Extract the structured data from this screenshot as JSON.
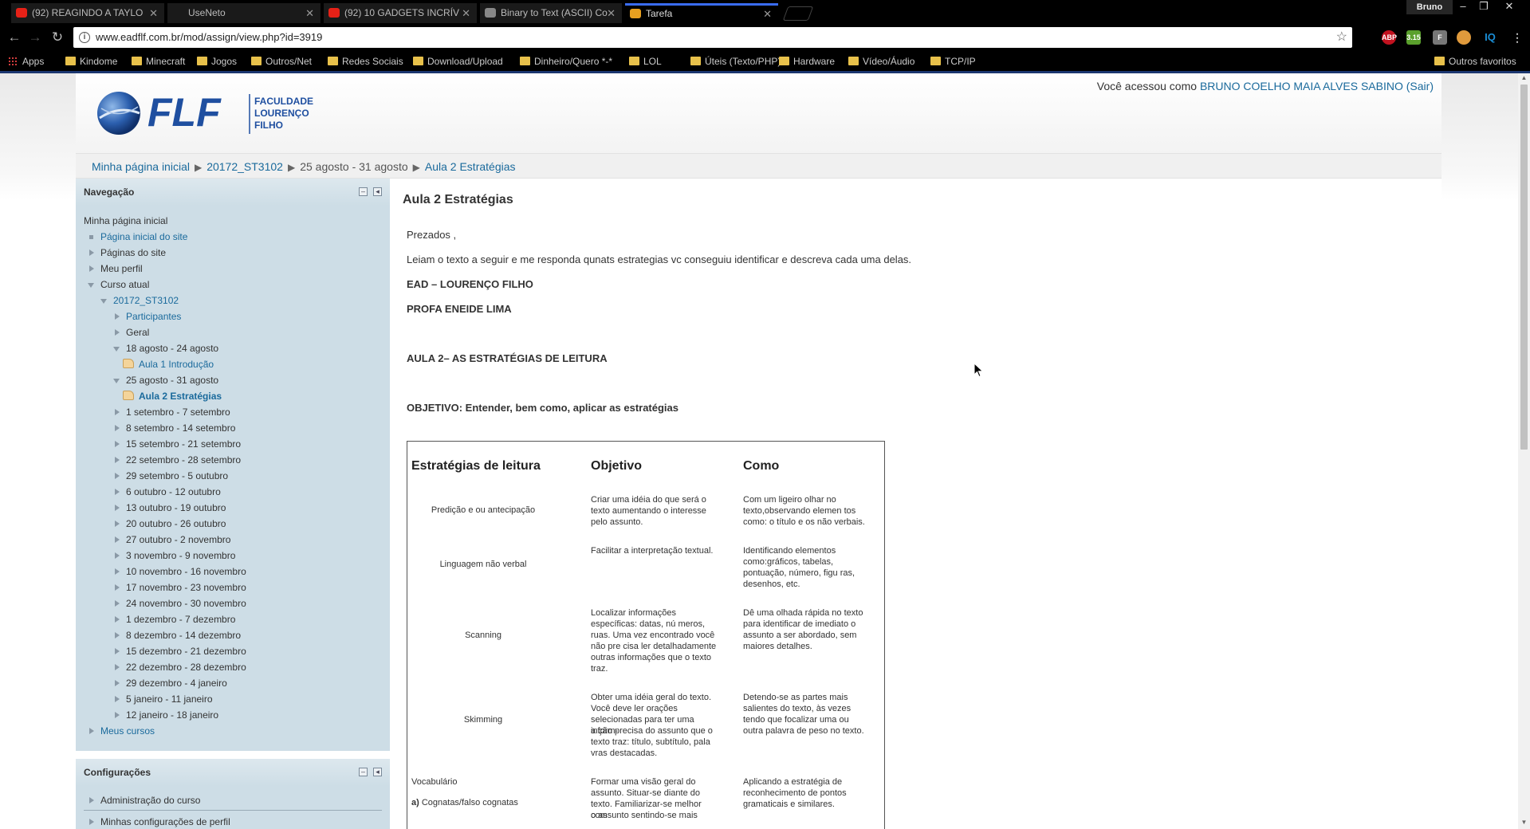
{
  "browser": {
    "tabs": [
      {
        "title": "(92) REAGINDO A TAYLO",
        "icon_color": "#e62117"
      },
      {
        "title": "UseNeto",
        "icon_color": ""
      },
      {
        "title": "(92) 10 GADGETS INCRÍV",
        "icon_color": "#e62117"
      },
      {
        "title": "Binary to Text (ASCII) Co",
        "icon_color": "#888888"
      },
      {
        "title": "Tarefa",
        "icon_color": "#e8a020"
      }
    ],
    "profile_name": "Bruno",
    "url_display": "www.eadflf.com.br/mod/assign/view.php?id=3919",
    "bookmarks": [
      "Apps",
      "Kindome",
      "Minecraft",
      "Jogos",
      "Outros/Net",
      "Redes Sociais",
      "Download/Upload",
      "Dinheiro/Quero *-*",
      "LOL",
      "Úteis (Texto/PHP)",
      "Hardware",
      "Vídeo/Áudio",
      "TCP/IP"
    ],
    "other_bookmarks": "Outros favoritos",
    "extensions": [
      {
        "label": "ABP",
        "color": "#c1121f"
      },
      {
        "label": "3.15",
        "color": "#5aa02c"
      },
      {
        "label": "F",
        "color": "#777777"
      },
      {
        "label": "",
        "color": "#e09a3c"
      },
      {
        "label": "IQ",
        "color": "#1a8fd8"
      }
    ]
  },
  "site": {
    "logo_text": "FLF",
    "logo_subtitle": [
      "FACULDADE",
      "LOURENÇO",
      "FILHO"
    ],
    "brand_color": "#1f4fa0",
    "login_prefix": "Você acessou como",
    "user_name": "BRUNO COELHO MAIA ALVES SABINO",
    "logout": "(Sair)",
    "breadcrumb": [
      "Minha página inicial",
      "20172_ST3102",
      "25 agosto - 31 agosto",
      "Aula 2 Estratégias"
    ]
  },
  "navigation": {
    "title": "Navegação",
    "home": "Minha página inicial",
    "items": [
      {
        "label": "Página inicial do site",
        "marker": "square",
        "link": true
      },
      {
        "label": "Páginas do site",
        "marker": "closed",
        "link": false
      },
      {
        "label": "Meu perfil",
        "marker": "closed",
        "link": false
      },
      {
        "label": "Curso atual",
        "marker": "open",
        "link": false
      },
      {
        "label": "20172_ST3102",
        "marker": "open",
        "link": true
      },
      {
        "label": "Participantes",
        "marker": "closed",
        "link": true
      },
      {
        "label": "Geral",
        "marker": "closed",
        "link": false
      },
      {
        "label": "18 agosto - 24 agosto",
        "marker": "open",
        "link": false
      },
      {
        "label": "Aula 1 Introdução",
        "marker": "resource",
        "link": true
      },
      {
        "label": "25 agosto - 31 agosto",
        "marker": "open",
        "link": false
      },
      {
        "label": "Aula 2 Estratégias",
        "marker": "resource",
        "link": true,
        "current": true
      },
      {
        "label": "1 setembro - 7 setembro",
        "marker": "closed",
        "link": false
      },
      {
        "label": "8 setembro - 14 setembro",
        "marker": "closed",
        "link": false
      },
      {
        "label": "15 setembro - 21 setembro",
        "marker": "closed",
        "link": false
      },
      {
        "label": "22 setembro - 28 setembro",
        "marker": "closed",
        "link": false
      },
      {
        "label": "29 setembro - 5 outubro",
        "marker": "closed",
        "link": false
      },
      {
        "label": "6 outubro - 12 outubro",
        "marker": "closed",
        "link": false
      },
      {
        "label": "13 outubro - 19 outubro",
        "marker": "closed",
        "link": false
      },
      {
        "label": "20 outubro - 26 outubro",
        "marker": "closed",
        "link": false
      },
      {
        "label": "27 outubro - 2 novembro",
        "marker": "closed",
        "link": false
      },
      {
        "label": "3 novembro - 9 novembro",
        "marker": "closed",
        "link": false
      },
      {
        "label": "10 novembro - 16 novembro",
        "marker": "closed",
        "link": false
      },
      {
        "label": "17 novembro - 23 novembro",
        "marker": "closed",
        "link": false
      },
      {
        "label": "24 novembro - 30 novembro",
        "marker": "closed",
        "link": false
      },
      {
        "label": "1 dezembro - 7 dezembro",
        "marker": "closed",
        "link": false
      },
      {
        "label": "8 dezembro - 14 dezembro",
        "marker": "closed",
        "link": false
      },
      {
        "label": "15 dezembro - 21 dezembro",
        "marker": "closed",
        "link": false
      },
      {
        "label": "22 dezembro - 28 dezembro",
        "marker": "closed",
        "link": false
      },
      {
        "label": "29 dezembro - 4 janeiro",
        "marker": "closed",
        "link": false
      },
      {
        "label": "5 janeiro - 11 janeiro",
        "marker": "closed",
        "link": false
      },
      {
        "label": "12 janeiro - 18 janeiro",
        "marker": "closed",
        "link": false
      },
      {
        "label": "Meus cursos",
        "marker": "closed",
        "link": true
      }
    ]
  },
  "settings": {
    "title": "Configurações",
    "items": [
      "Administração do curso",
      "Minhas configurações de perfil"
    ]
  },
  "assignment": {
    "title": "Aula 2 Estratégias",
    "greeting": "Prezados ,",
    "instruction": "Leiam o texto a seguir e me responda qunats estrategias vc conseguiu identificar e descreva cada uma delas.",
    "line1": "EAD – LOURENÇO FILHO",
    "line2": "PROFA ENEIDE LIMA",
    "line3": "AULA 2– AS ESTRATÉGIAS DE LEITURA",
    "line4": "OBJETIVO: Entender, bem como,  aplicar as estratégias",
    "table": {
      "headers": [
        "Estratégias de leitura",
        "Objetivo",
        "Como"
      ],
      "rows": [
        {
          "strategy": "Predição e ou antecipação",
          "objective": [
            "Criar uma idéia do que será o",
            "texto aumentando o interesse",
            "pelo assunto."
          ],
          "how": [
            "Com um ligeiro olhar no",
            "texto,observando elemen tos",
            "como: o título e os não verbais."
          ]
        },
        {
          "strategy": "Linguagem não verbal",
          "objective": [
            "Facilitar a interpretação textual."
          ],
          "how": [
            "Identificando elementos",
            "como:gráficos, tabelas,",
            "pontuação, número, figu ras,",
            "desenhos, etc."
          ]
        },
        {
          "strategy": "Scanning",
          "objective": [
            "Localizar informações",
            "específicas: datas, nú meros,",
            "ruas. Uma vez encontrado você",
            "não pre cisa ler detalhadamente",
            "outras informações que o texto",
            "traz."
          ],
          "how": [
            "Dê uma olhada rápida no texto",
            "para identificar de imediato o",
            "assunto a ser abordado, sem",
            "maiores detalhes."
          ]
        },
        {
          "strategy": "Skimming",
          "objective": [
            "Obter uma idéia geral do texto.",
            "Você deve ler orações",
            "selecionadas para ter uma inform-",
            "a ção precisa do assunto que o",
            "texto traz: título, subtítulo, pala",
            "vras destacadas."
          ],
          "how": [
            "Detendo-se as partes mais",
            "salientes do texto, às vezes",
            "tendo que focalizar uma ou",
            "outra palavra de peso no texto."
          ]
        },
        {
          "strategy": "Vocabulário",
          "sub_marker": "a)",
          "sub_label": "Cognatas/falso cognatas",
          "objective": [
            "Formar uma visão geral do",
            "assunto. Situar-se diante do",
            "texto. Familiarizar-se melhor com",
            "o assunto sentindo-se mais"
          ],
          "how": [
            "Aplicando a estratégia de",
            "reconhecimento de pontos",
            "gramaticais e similares."
          ]
        }
      ]
    }
  }
}
